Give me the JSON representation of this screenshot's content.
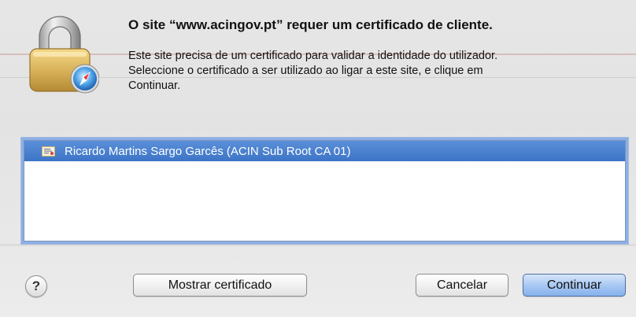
{
  "dialog": {
    "title": "O site “www.acingov.pt” requer um certificado de cliente.",
    "message_line1": "Este site precisa de um certificado para validar a identidade do utilizador.",
    "message_line2": "Seleccione o certificado a ser utilizado ao ligar a este site, e clique em",
    "message_line3": "Continuar.",
    "lock_icon": "padlock-safari-icon"
  },
  "certificates": [
    {
      "label": "Ricardo Martins Sargo Garcês  (ACIN Sub Root CA 01)",
      "selected": true,
      "icon": "certificate-icon"
    }
  ],
  "buttons": {
    "help_label": "?",
    "show_certificate_label": "Mostrar certificado",
    "cancel_label": "Cancelar",
    "continue_label": "Continuar"
  },
  "colors": {
    "selection": "#3d74c7",
    "default_button": "#86b1ec",
    "focus_ring": "#8ab0e8"
  }
}
